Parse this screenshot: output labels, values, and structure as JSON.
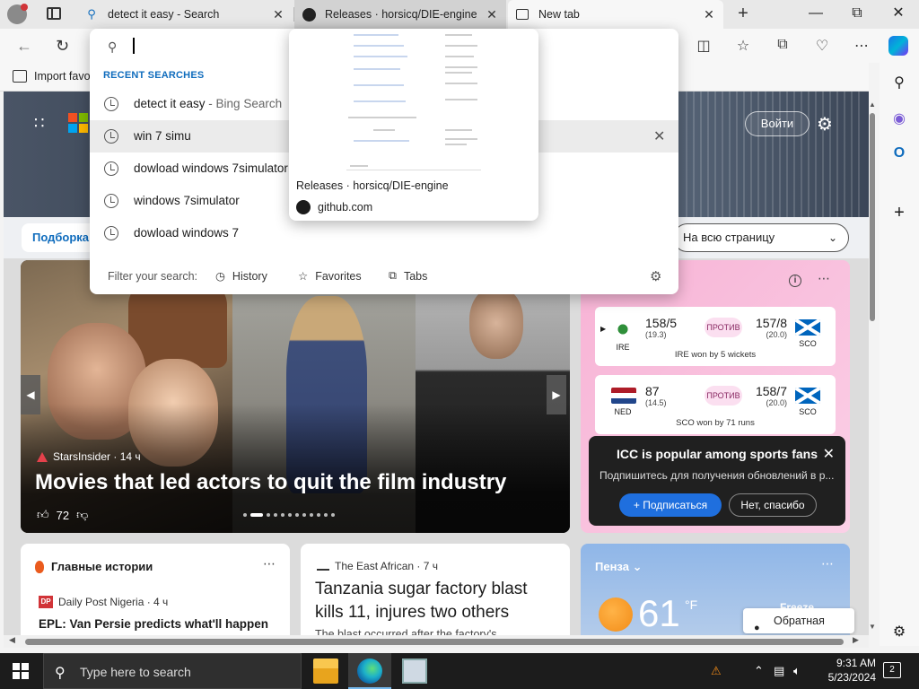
{
  "browser": {
    "tabs": [
      {
        "title": "detect it easy - Search",
        "favicon": "search-icon"
      },
      {
        "title": "Releases · horsicq/DIE-engine",
        "favicon": "github-icon"
      },
      {
        "title": "New tab",
        "favicon": "newtab-icon"
      }
    ],
    "favorites_bar": {
      "import_label": "Import favo"
    }
  },
  "address_dropdown": {
    "section_title": "RECENT SEARCHES",
    "items": [
      {
        "text": "detect it easy",
        "suffix": " - Bing Search"
      },
      {
        "text": "win 7 simu",
        "suffix": ""
      },
      {
        "text": "dowload windows 7simulator",
        "suffix": ""
      },
      {
        "text": "windows 7simulator",
        "suffix": ""
      },
      {
        "text": "dowload windows 7",
        "suffix": ""
      }
    ],
    "filter_label": "Filter your search:",
    "filters": [
      "History",
      "Favorites",
      "Tabs"
    ]
  },
  "tab_preview": {
    "title": "Releases · horsicq/DIE-engine",
    "domain": "github.com"
  },
  "msn": {
    "login_label": "Войти",
    "podborka_label": "Подборка",
    "layout_option": "На всю страницу",
    "hero": {
      "source": "StarsInsider · 14 ч",
      "title": "Movies that led actors to quit the film industry",
      "likes": "72"
    },
    "sports": {
      "matches": [
        {
          "teamA": "IRE",
          "scoreA": "158/5",
          "oversA": "(19.3)",
          "vs": "ПРОТИВ",
          "scoreB": "157/8",
          "oversB": "(20.0)",
          "teamB": "SCO",
          "result": "IRE won by 5 wickets"
        },
        {
          "teamA": "NED",
          "scoreA": "87",
          "oversA": "(14.5)",
          "vs": "ПРОТИВ",
          "scoreB": "158/7",
          "oversB": "(20.0)",
          "teamB": "SCO",
          "result": "SCO won by 71 runs"
        }
      ],
      "popup": {
        "title": "ICC is popular among sports fans",
        "subtitle": "Подпишитесь для получения обновлений в р...",
        "subscribe_label": "Подписаться",
        "decline_label": "Нет, спасибо"
      }
    },
    "top_stories": {
      "heading": "Главные истории",
      "source": "Daily Post Nigeria · 4 ч",
      "source_badge": "DP",
      "title": "EPL: Van Persie predicts what'll happen"
    },
    "news2": {
      "source": "The East African · 7 ч",
      "title": "Tanzania sugar factory blast kills 11, injures two others",
      "sub": "The blast occurred after the factory's"
    },
    "weather": {
      "city": "Пенза",
      "temp": "61",
      "unit": "°F",
      "alert": "Freeze"
    },
    "feedback_label": "Обратная связь"
  },
  "taskbar": {
    "search_placeholder": "Type here to search",
    "time": "9:31 AM",
    "date": "5/23/2024",
    "notifications": "2"
  }
}
